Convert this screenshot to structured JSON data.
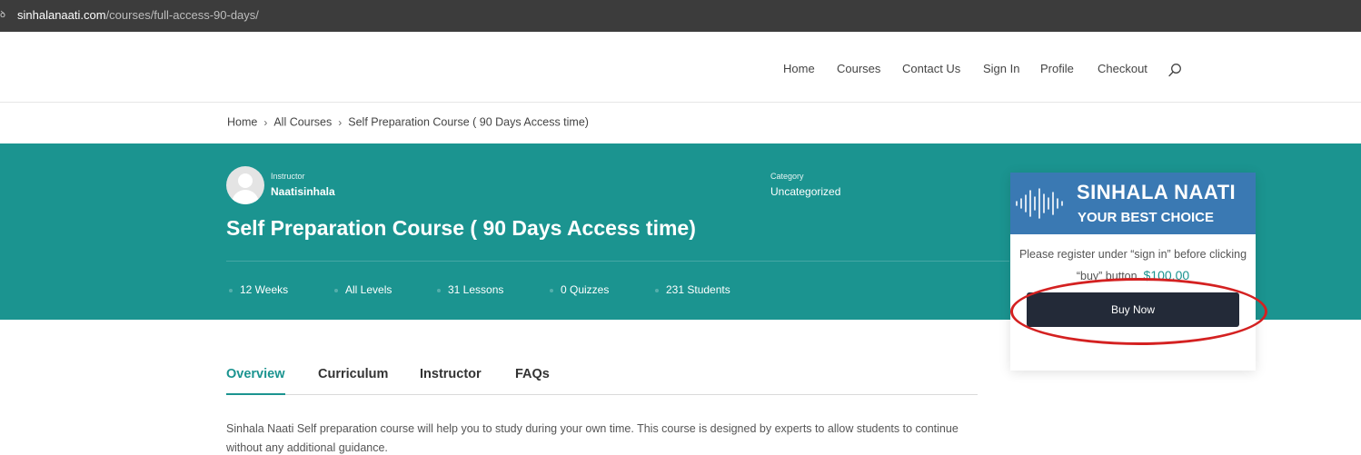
{
  "browser": {
    "url_host": "sinhalanaati.com",
    "url_path": "/courses/full-access-90-days/"
  },
  "nav": {
    "items": [
      "Home",
      "Courses",
      "Contact Us",
      "Sign In",
      "Profile",
      "Checkout"
    ]
  },
  "breadcrumb": [
    "Home",
    "All Courses",
    "Self Preparation Course ( 90 Days Access time)"
  ],
  "course": {
    "instructor_label": "Instructor",
    "instructor_name": "Naatisinhala",
    "category_label": "Category",
    "category_value": "Uncategorized",
    "title": "Self Preparation Course ( 90 Days Access time)",
    "stats": [
      "12 Weeks",
      "All Levels",
      "31 Lessons",
      "0 Quizzes",
      "231 Students"
    ]
  },
  "card": {
    "banner_line1": "SINHALA NAATI",
    "banner_line2": "YOUR BEST CHOICE",
    "note": "Please register under “sign in” before clicking “buy” button.",
    "price": "$100.00",
    "buy_label": "Buy Now"
  },
  "tabs": [
    "Overview",
    "Curriculum",
    "Instructor",
    "FAQs"
  ],
  "description": "Sinhala Naati Self preparation course will help you to study during your own time. This course is designed by experts to allow students to continue without any additional guidance.",
  "colors": {
    "teal": "#1b9490",
    "banner_blue": "#3a79b3",
    "button_dark": "#232a38",
    "highlight_red": "#d42121"
  }
}
